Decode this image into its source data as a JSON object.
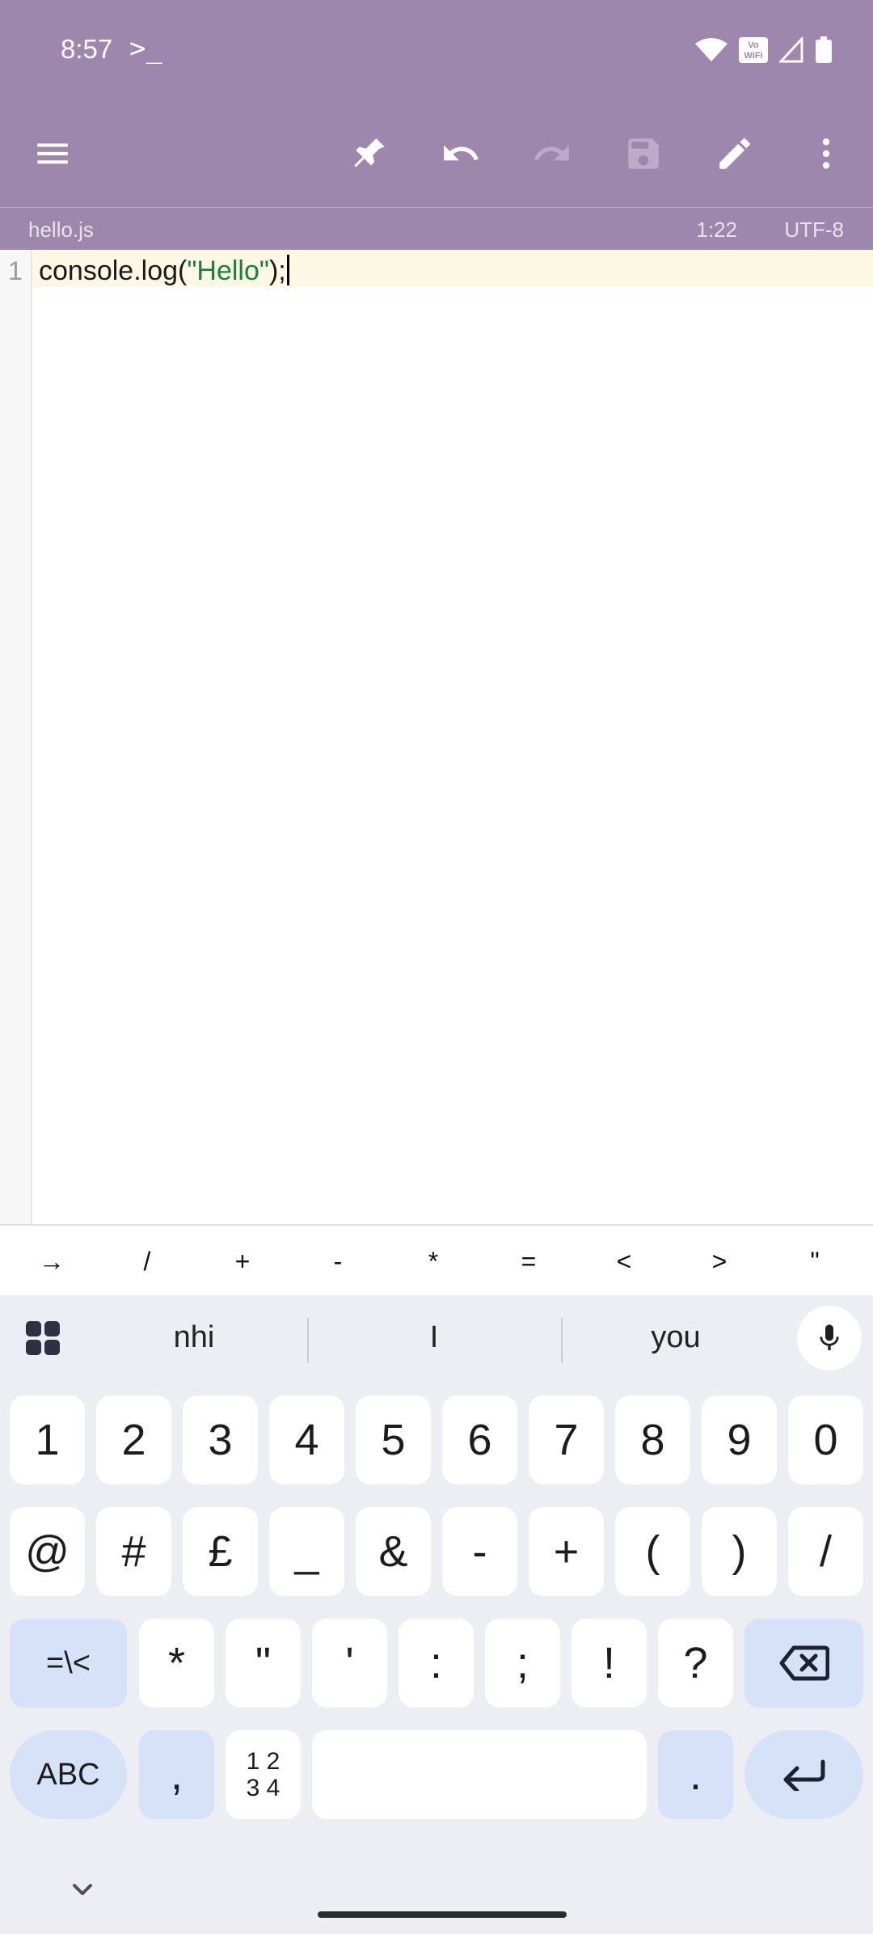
{
  "status_bar": {
    "time": "8:57",
    "app_indicator": ">_",
    "vowifi_label": "Vo WiFi"
  },
  "toolbar": {
    "menu_icon": "hamburger-menu-icon",
    "actions": [
      "pin",
      "undo",
      "redo",
      "save",
      "edit",
      "more-options"
    ]
  },
  "file_info": {
    "file_name": "hello.js",
    "cursor_position": "1:22",
    "encoding": "UTF-8"
  },
  "editor": {
    "line_number": "1",
    "code_before": "console.log(",
    "code_string": "\"Hello\"",
    "code_after": ");"
  },
  "symbols": [
    "→",
    "/",
    "+",
    "-",
    "*",
    "=",
    "<",
    ">",
    "\""
  ],
  "keyboard": {
    "suggestions": [
      "nhi",
      "I",
      "you"
    ],
    "row1": [
      "1",
      "2",
      "3",
      "4",
      "5",
      "6",
      "7",
      "8",
      "9",
      "0"
    ],
    "row2": [
      "@",
      "#",
      "£",
      "_",
      "&",
      "-",
      "+",
      "(",
      ")",
      "/"
    ],
    "row3_left": "=\\<",
    "row3": [
      "*",
      "\"",
      "'",
      ":",
      ";",
      "!",
      "?"
    ],
    "abc_label": "ABC",
    "comma": ",",
    "numpad_label_top": "1 2",
    "numpad_label_bottom": "3 4",
    "period": "."
  },
  "colors": {
    "app_bar": "#9e87ac",
    "current_line": "#fdf8e4",
    "string": "#188038",
    "keyboard_bg": "#eceef4",
    "key_accent": "#d6e2f7"
  }
}
